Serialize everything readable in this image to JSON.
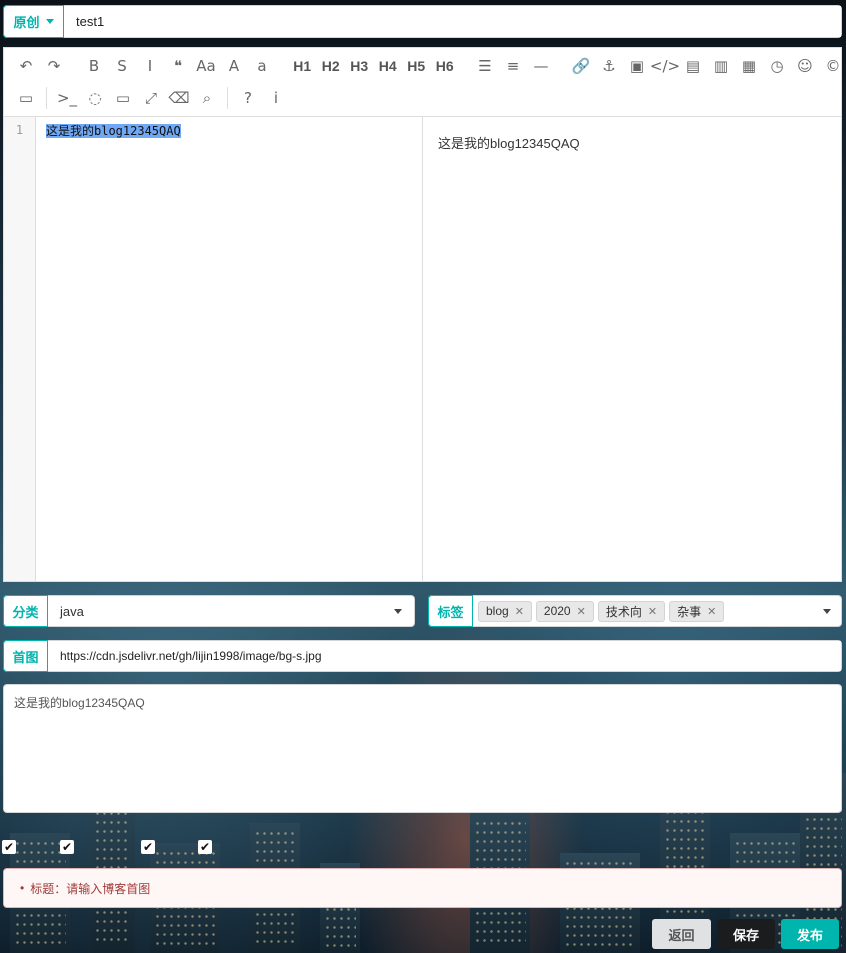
{
  "title_row": {
    "type_label": "原创",
    "title_value": "test1"
  },
  "toolbar": {
    "row1": [
      "undo-icon",
      "redo-icon",
      "|",
      "bold-icon",
      "strikethrough-icon",
      "italic-icon",
      "quote-icon",
      "uppercase-icon",
      "ucwords-icon",
      "lowercase-icon",
      "|",
      "H1",
      "H2",
      "H3",
      "H4",
      "H5",
      "H6",
      "|",
      "list-ul-icon",
      "list-ol-icon",
      "hr-icon",
      "|",
      "link-icon",
      "anchor-icon",
      "image-icon",
      "code-icon",
      "preformatted-icon",
      "code-block-icon",
      "table-icon",
      "datetime-icon",
      "emoji-icon",
      "html-entities-icon"
    ],
    "row2": [
      "pagebreak-icon",
      "|",
      "terminal-icon",
      "watch-icon",
      "preview-icon",
      "fullscreen-icon",
      "clear-icon",
      "search-icon",
      "|",
      "help-icon",
      "info-icon"
    ],
    "glyphs": {
      "undo-icon": "↶",
      "redo-icon": "↷",
      "bold-icon": "B",
      "strikethrough-icon": "S",
      "italic-icon": "I",
      "quote-icon": "❝",
      "uppercase-icon": "Aa",
      "ucwords-icon": "A",
      "lowercase-icon": "a",
      "list-ul-icon": "☰",
      "list-ol-icon": "≡",
      "hr-icon": "—",
      "link-icon": "🔗",
      "anchor-icon": "⚓",
      "image-icon": "▣",
      "code-icon": "</>",
      "preformatted-icon": "▤",
      "code-block-icon": "▥",
      "table-icon": "▦",
      "datetime-icon": "◷",
      "emoji-icon": "☺",
      "html-entities-icon": "©",
      "pagebreak-icon": "▭",
      "terminal-icon": ">_",
      "watch-icon": "◌",
      "preview-icon": "▭",
      "fullscreen-icon": "⤢",
      "clear-icon": "⌫",
      "search-icon": "⌕",
      "help-icon": "?",
      "info-icon": "i"
    }
  },
  "editor": {
    "line_number": "1",
    "code_text": "这是我的blog12345QAQ",
    "preview_text": "这是我的blog12345QAQ"
  },
  "category": {
    "label": "分类",
    "value": "java"
  },
  "tags": {
    "label": "标签",
    "items": [
      "blog",
      "2020",
      "技术向",
      "杂事"
    ]
  },
  "cover": {
    "label": "首图",
    "value": "https://cdn.jsdelivr.net/gh/lijin1998/image/bg-s.jpg"
  },
  "description": {
    "value": "这是我的blog12345QAQ"
  },
  "checkboxes": [
    "✔",
    "✔",
    "✔",
    "✔"
  ],
  "error": {
    "bullet": "•",
    "message": "标题：请输入博客首图"
  },
  "actions": {
    "back": "返回",
    "save": "保存",
    "publish": "发布"
  }
}
